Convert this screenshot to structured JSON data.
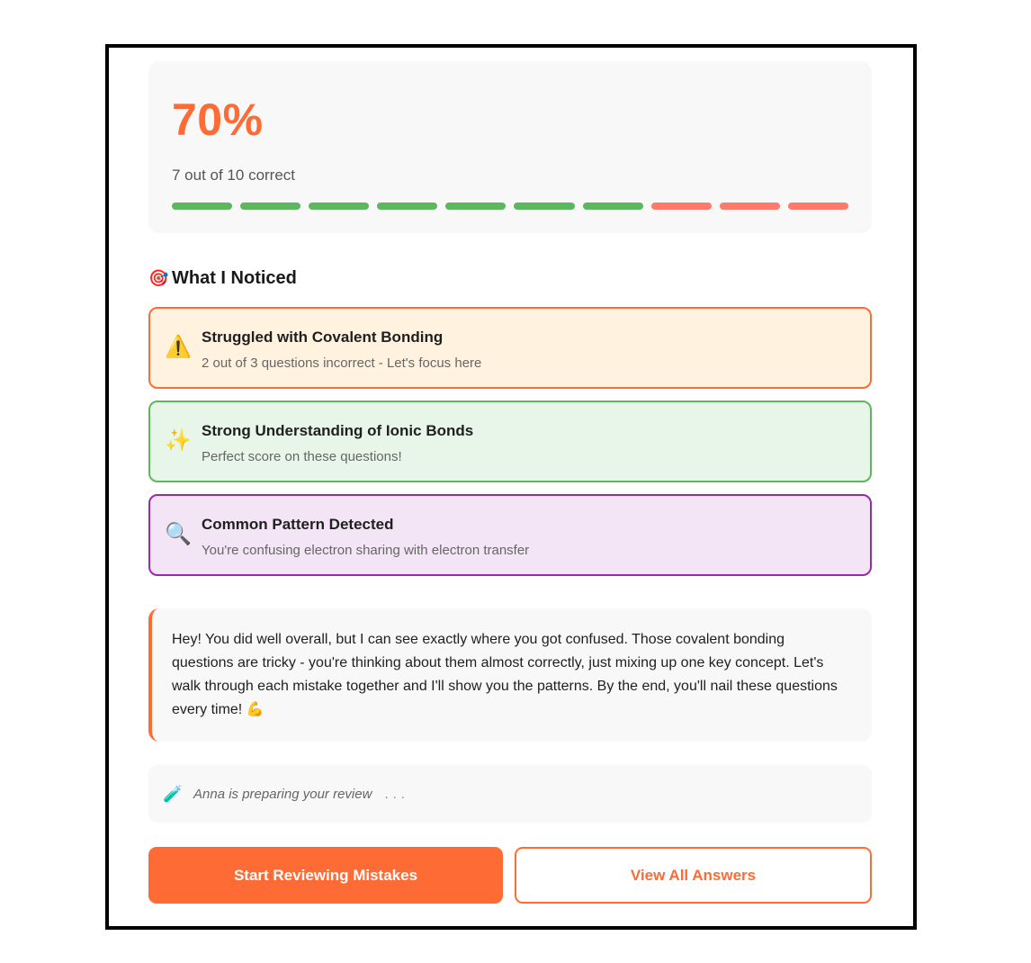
{
  "score": {
    "percent": "70%",
    "summary": "7 out of 10 correct",
    "correct": 7,
    "total": 10,
    "colors": {
      "correct": "#5cb85c",
      "incorrect": "#ff7a6b",
      "accent": "#ff6b35"
    }
  },
  "insights_section": {
    "icon": "target-icon",
    "icon_glyph": "🎯",
    "title": "What I Noticed"
  },
  "insights": [
    {
      "icon": "warning-icon",
      "glyph": "⚠️",
      "title": "Struggled with Covalent Bonding",
      "description": "2 out of 3 questions incorrect - Let's focus here",
      "bg": "#fff3e0",
      "border": "#ff6b35"
    },
    {
      "icon": "sparkles-icon",
      "glyph": "✨",
      "title": "Strong Understanding of Ionic Bonds",
      "description": "Perfect score on these questions!",
      "bg": "#e8f5e9",
      "border": "#5cb85c"
    },
    {
      "icon": "magnifier-icon",
      "glyph": "🔍",
      "title": "Common Pattern Detected",
      "description": "You're confusing electron sharing with electron transfer",
      "bg": "#f3e5f5",
      "border": "#9c27b0"
    }
  ],
  "message": {
    "text": "Hey! You did well overall, but I can see exactly where you got confused. Those covalent bonding questions are tricky - you're thinking about them almost correctly, just mixing up one key concept. Let's walk through each mistake together and I'll show you the patterns. By the end, you'll nail these questions every time!",
    "emoji_icon": "flexed-biceps-icon",
    "emoji": "💪"
  },
  "status": {
    "icon": "test-tube-icon",
    "glyph": "🧪",
    "text": "Anna is preparing your review",
    "dots": "..."
  },
  "actions": {
    "primary_label": "Start Reviewing Mistakes",
    "secondary_label": "View All Answers"
  }
}
